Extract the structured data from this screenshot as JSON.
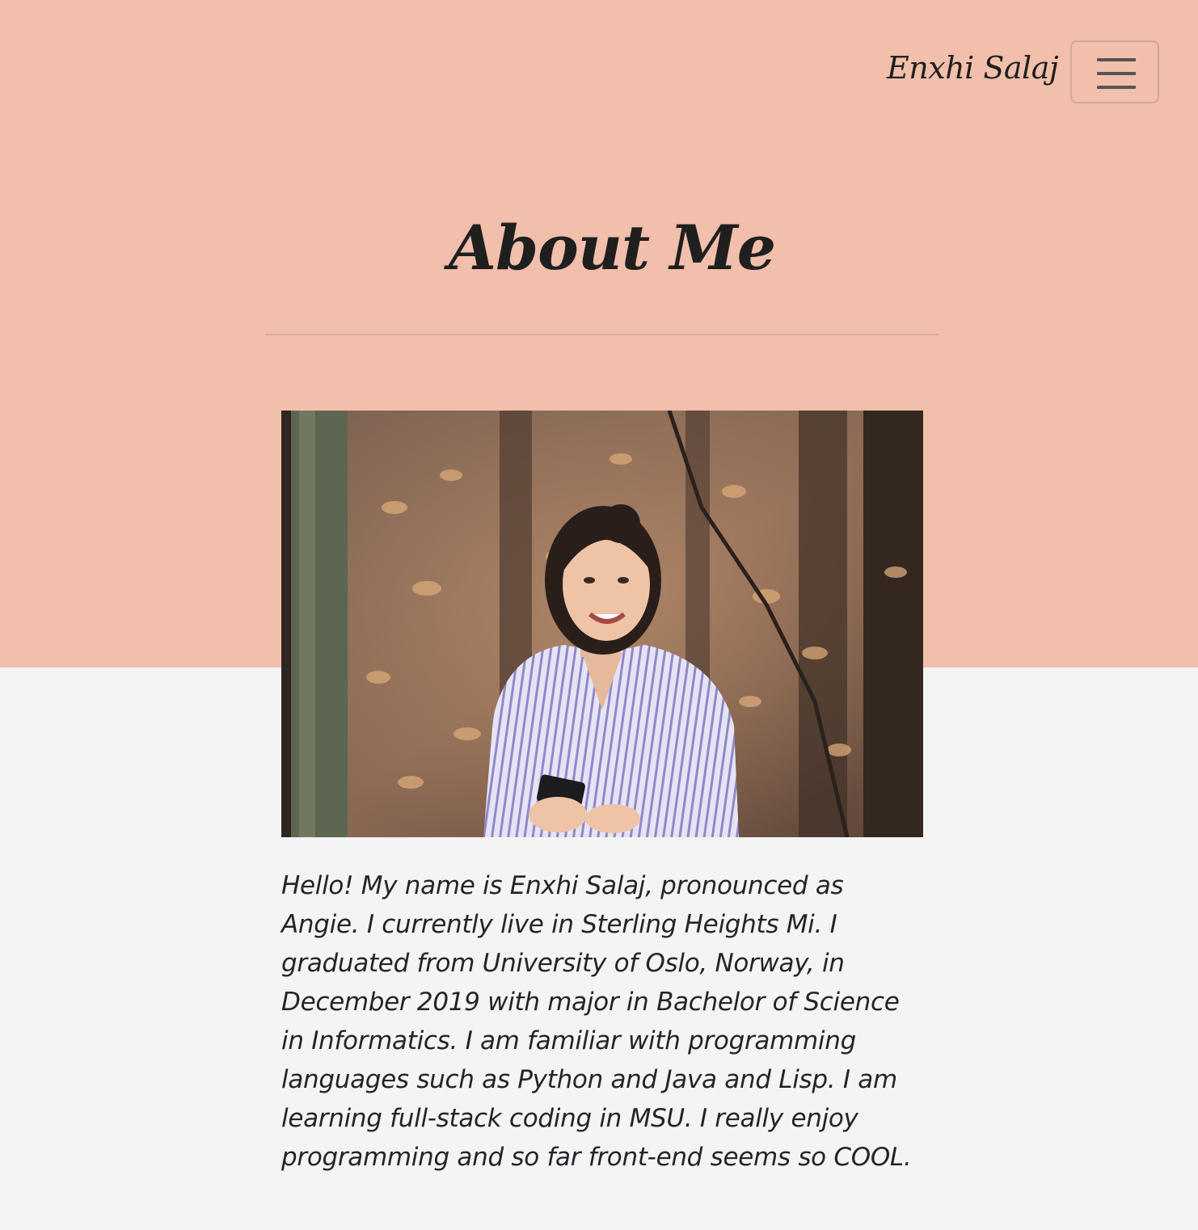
{
  "navbar": {
    "brand": "Enxhi Salaj",
    "toggle_icon": "hamburger-menu-icon"
  },
  "about": {
    "title": "About Me",
    "photo_alt": "Enxhi Salaj smiling in a forest",
    "bio": "Hello! My name is Enxhi Salaj, pronounced as Angie. I currently live in Sterling Heights Mi. I graduated from University of Oslo, Norway, in December 2019 with major in Bachelor of Science in Informatics. I am familiar with programming languages such as Python and Java and Lisp. I am learning full-stack coding in MSU. I really enjoy programming and so far front-end seems so COOL."
  },
  "colors": {
    "hero_background": "#f1bfab",
    "page_background": "#f4f4f4",
    "text": "#212529"
  }
}
